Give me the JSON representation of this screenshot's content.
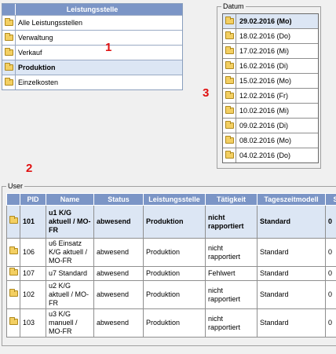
{
  "leistungsstelle": {
    "header": "Leistungsstelle",
    "items": [
      {
        "label": "Alle Leistungsstellen",
        "selected": false
      },
      {
        "label": "Verwaltung",
        "selected": false
      },
      {
        "label": "Verkauf",
        "selected": false
      },
      {
        "label": "Produktion",
        "selected": true
      },
      {
        "label": "Einzelkosten",
        "selected": false
      }
    ],
    "icon": "folder-icon"
  },
  "datum": {
    "legend": "Datum",
    "items": [
      {
        "label": "29.02.2016 (Mo)",
        "selected": true
      },
      {
        "label": "18.02.2016 (Do)",
        "selected": false
      },
      {
        "label": "17.02.2016 (Mi)",
        "selected": false
      },
      {
        "label": "16.02.2016 (Di)",
        "selected": false
      },
      {
        "label": "15.02.2016 (Mo)",
        "selected": false
      },
      {
        "label": "12.02.2016 (Fr)",
        "selected": false
      },
      {
        "label": "10.02.2016 (Mi)",
        "selected": false
      },
      {
        "label": "09.02.2016 (Di)",
        "selected": false
      },
      {
        "label": "08.02.2016 (Mo)",
        "selected": false
      },
      {
        "label": "04.02.2016 (Do)",
        "selected": false
      }
    ]
  },
  "markers": {
    "one": "1",
    "two": "2",
    "three": "3"
  },
  "user": {
    "legend": "User",
    "columns": [
      "",
      "PID",
      "Name",
      "Status",
      "Leistungsstelle",
      "Tätigkeit",
      "Tageszeitmodell",
      "S"
    ],
    "rows": [
      {
        "selected": true,
        "cells": [
          "101",
          "u1 K/G aktuell / MO-FR",
          "abwesend",
          "Produktion",
          "nicht rapportiert",
          "Standard",
          "0"
        ]
      },
      {
        "selected": false,
        "cells": [
          "106",
          "u6 Einsatz K/G aktuell / MO-FR",
          "abwesend",
          "Produktion",
          "nicht rapportiert",
          "Standard",
          "0"
        ]
      },
      {
        "selected": false,
        "cells": [
          "107",
          "u7 Standard",
          "abwesend",
          "Produktion",
          "Fehlwert",
          "Standard",
          "0"
        ]
      },
      {
        "selected": false,
        "cells": [
          "102",
          "u2 K/G aktuell / MO-FR",
          "abwesend",
          "Produktion",
          "nicht rapportiert",
          "Standard",
          "0"
        ]
      },
      {
        "selected": false,
        "cells": [
          "103",
          "u3 K/G manuell / MO-FR",
          "abwesend",
          "Produktion",
          "nicht rapportiert",
          "Standard",
          "0"
        ]
      }
    ]
  },
  "colors": {
    "header": "#7b95c6",
    "selected_row": "#dce6f4",
    "marker": "#e01010"
  }
}
